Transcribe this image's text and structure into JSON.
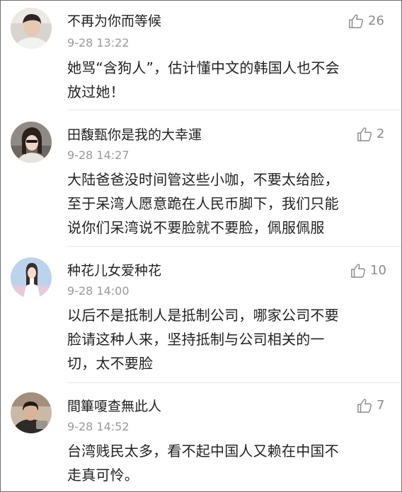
{
  "comments": [
    {
      "username": "不再为你而等候",
      "time": "9-28 13:22",
      "likes": "26",
      "text_lines": [
        "她骂“含狗人”，估计懂中文的韩国人也不会",
        "放过她！"
      ],
      "avatar_colors": {
        "bg": "#d9d4cd",
        "hair": "#2b2624",
        "skin": "#e6c9b3",
        "shirt": "#f2f2f0"
      }
    },
    {
      "username": "田馥甄你是我的大幸運",
      "time": "9-28 14:27",
      "likes": "2",
      "text_lines": [
        "大陆爸爸没时间管这些小咖，不要太给脸，",
        "至于呆湾人愿意跪在人民币脚下，我们只能",
        "说你们呆湾说不要脸就不要脸，佩服佩服"
      ],
      "avatar_colors": {
        "bg": "#8f8a86",
        "hair": "#2a211d",
        "skin": "#f0d6c6",
        "shirt": "#e9e3de"
      }
    },
    {
      "username": "种花儿女爱种花",
      "time": "9-28 14:00",
      "likes": "10",
      "text_lines": [
        "以后不是抵制人是抵制公司，哪家公司不要",
        "脸请这种人来，坚持抵制与公司相关的一",
        "切，太不要脸"
      ],
      "avatar_colors": {
        "bg": "#bcd3ee",
        "hair": "#3a2e2b",
        "skin": "#f3ddd0",
        "shirt": "#ffffff"
      }
    },
    {
      "username": "間篳嗄查無此人",
      "time": "9-28 14:52",
      "likes": "7",
      "text_lines": [
        "台湾贱民太多，看不起中国人又赖在中国不",
        "走真可怜。"
      ],
      "avatar_colors": {
        "bg": "#cbb9a7",
        "hair": "#1f1a18",
        "skin": "#d9b49a",
        "shirt": "#2d2a29"
      }
    }
  ]
}
